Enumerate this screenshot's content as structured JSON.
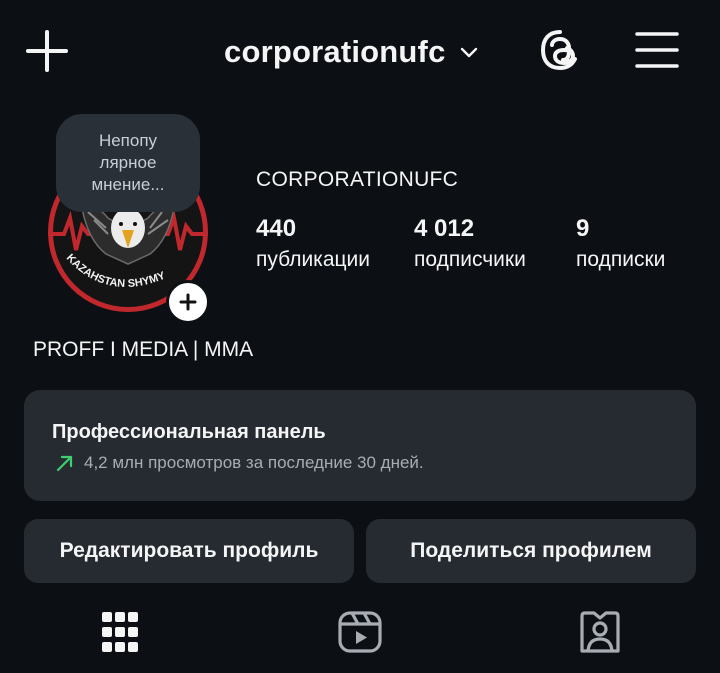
{
  "header": {
    "username_title": "corporationufc",
    "icons": [
      "plus-icon",
      "chevron-down-icon",
      "threads-icon",
      "menu-icon"
    ]
  },
  "profile": {
    "note": "Непопу лярное мнение...",
    "display_name": "CORPORATIONUFC",
    "avatar_text": "KAZAHSTAN SHYMY",
    "stats": [
      {
        "value": "440",
        "label": "публикации"
      },
      {
        "value": "4 012",
        "label": "подписчики"
      },
      {
        "value": "9",
        "label": "подписки"
      }
    ],
    "bio": "PROFF I MEDIA | MMA"
  },
  "dashboard": {
    "title": "Профессиональная панель",
    "subtitle": "4,2 млн просмотров за последние 30 дней.",
    "trend_color": "#3ecf6e"
  },
  "actions": {
    "edit_label": "Редактировать профиль",
    "share_label": "Поделиться профилем"
  },
  "tabs": [
    "grid-icon",
    "reels-icon",
    "tagged-icon"
  ],
  "colors": {
    "background": "#0c1014",
    "card": "#262b31",
    "accent_red": "#c0282d"
  }
}
